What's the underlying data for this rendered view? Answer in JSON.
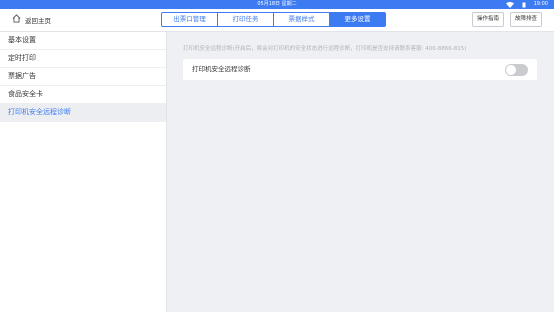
{
  "statusbar": {
    "date": "05月18日 星期二",
    "time": "19:00",
    "wifi_icon": "wifi-icon",
    "battery_icon": "battery-icon"
  },
  "header": {
    "home_icon": "home-icon",
    "home_label": "返回主页",
    "tabs": [
      {
        "label": "出票口管理",
        "active": false
      },
      {
        "label": "打印任务",
        "active": false
      },
      {
        "label": "票据样式",
        "active": false
      },
      {
        "label": "更多设置",
        "active": true
      }
    ],
    "guide_button": "操作指南",
    "troubleshoot_button": "故障排查"
  },
  "sidebar": {
    "items": [
      {
        "label": "基本设置",
        "active": false
      },
      {
        "label": "定时打印",
        "active": false
      },
      {
        "label": "票据广告",
        "active": false
      },
      {
        "label": "食品安全卡",
        "active": false
      },
      {
        "label": "打印机安全远程诊断",
        "active": true
      }
    ]
  },
  "main": {
    "description": "打印机安全远程诊断(开启后，将会对打印机的安全状态进行远程诊断，打印机是否支持请联系客服: 400-8866-815)",
    "setting": {
      "label": "打印机安全远程诊断",
      "enabled": false
    }
  },
  "colors": {
    "accent": "#3d7bf3",
    "background": "#eef0f3",
    "toggle_off": "#c9cbcf"
  }
}
